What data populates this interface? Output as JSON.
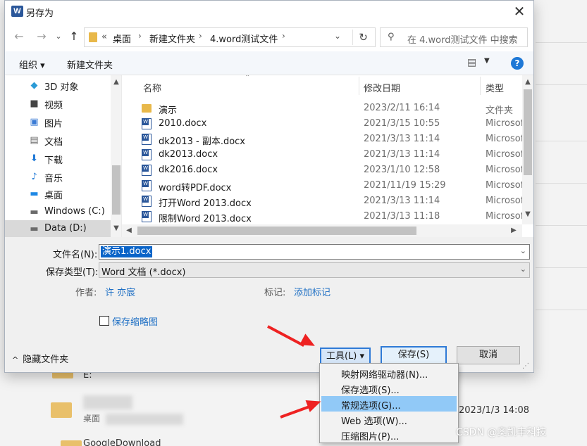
{
  "background": {
    "date_text": "2023/1/3 14:08",
    "drive_label": "E:",
    "folder_label": "桌面",
    "folder_item": "GoogleDownload"
  },
  "dialog": {
    "title": "另存为",
    "title_icon_letter": "W",
    "close_glyph": "✕"
  },
  "nav": {
    "back": "←",
    "forward": "→",
    "up": "↑",
    "breadcrumbs": [
      "«",
      "桌面",
      "新建文件夹",
      "4.word测试文件"
    ],
    "crumb_sep": "›",
    "address_chevron": "⌄",
    "refresh": "↻",
    "search_placeholder": "在 4.word测试文件 中搜索",
    "search_icon": "⚲"
  },
  "toolbar": {
    "organize": "组织 ▾",
    "new_folder": "新建文件夹",
    "view_icon": "▤",
    "view_drop": "▼",
    "help": "?"
  },
  "sidebar": {
    "items": [
      {
        "icon": "◆",
        "label": "3D 对象",
        "color": "#2b9bd6"
      },
      {
        "icon": "■",
        "label": "视频",
        "color": "#444444"
      },
      {
        "icon": "▣",
        "label": "图片",
        "color": "#3a7bd5"
      },
      {
        "icon": "▤",
        "label": "文档",
        "color": "#6b6b6b"
      },
      {
        "icon": "⬇",
        "label": "下载",
        "color": "#1e78d6"
      },
      {
        "icon": "♪",
        "label": "音乐",
        "color": "#1e78d6"
      },
      {
        "icon": "▬",
        "label": "桌面",
        "color": "#1e88e5"
      },
      {
        "icon": "▬",
        "label": "Windows (C:)",
        "color": "#6b6b6b"
      },
      {
        "icon": "▬",
        "label": "Data (D:)",
        "color": "#6b6b6b"
      }
    ]
  },
  "filelist": {
    "headers": {
      "name": "名称",
      "date": "修改日期",
      "type": "类型"
    },
    "rows": [
      {
        "kind": "folder",
        "name": "演示",
        "date": "2023/2/11 16:14",
        "type": "文件夹"
      },
      {
        "kind": "doc",
        "name": "2010.docx",
        "date": "2021/3/15 10:55",
        "type": "Microsoft"
      },
      {
        "kind": "doc",
        "name": "dk2013 - 副本.docx",
        "date": "2021/3/13 11:14",
        "type": "Microsoft"
      },
      {
        "kind": "doc",
        "name": "dk2013.docx",
        "date": "2021/3/13 11:14",
        "type": "Microsoft"
      },
      {
        "kind": "doc",
        "name": "dk2016.docx",
        "date": "2023/1/10 12:58",
        "type": "Microsoft"
      },
      {
        "kind": "doc",
        "name": "word转PDF.docx",
        "date": "2021/11/19 15:29",
        "type": "Microsoft"
      },
      {
        "kind": "doc",
        "name": "打开Word 2013.docx",
        "date": "2021/3/13 11:14",
        "type": "Microsoft"
      },
      {
        "kind": "doc",
        "name": "限制Word 2013.docx",
        "date": "2021/3/13 11:18",
        "type": "Microsoft"
      }
    ]
  },
  "form": {
    "filename_label": "文件名(N):",
    "filename_value": "演示1.docx",
    "filetype_label": "保存类型(T):",
    "filetype_value": "Word 文档 (*.docx)",
    "author_label": "作者:",
    "author_value": "许 亦宸",
    "tags_label": "标记:",
    "tags_value": "添加标记",
    "thumbnail_label": "保存缩略图",
    "hide_folders": "隐藏文件夹",
    "hide_chevron": "^"
  },
  "buttons": {
    "tools": "工具(L)  ▾",
    "save": "保存(S)",
    "cancel": "取消"
  },
  "tools_menu": {
    "items": [
      "映射网络驱动器(N)...",
      "保存选项(S)...",
      "常规选项(G)...",
      "Web 选项(W)...",
      "压缩图片(P)..."
    ],
    "highlighted_index": 2
  },
  "watermark": "CSDN @奥凯丰科技",
  "colors": {
    "accent": "#0a64c8",
    "link": "#1e6fc4",
    "highlight": "#91c9f7",
    "annotation": "#ee2222"
  }
}
